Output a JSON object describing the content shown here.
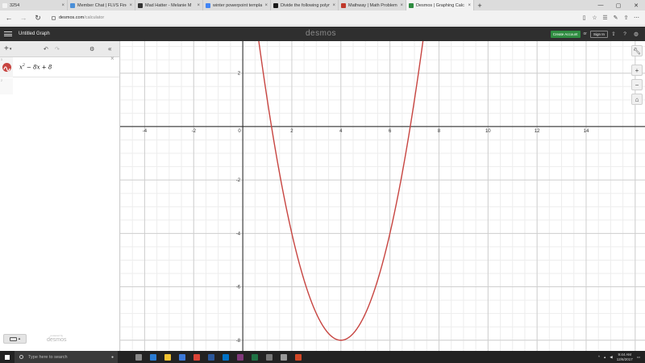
{
  "browser": {
    "tabs": [
      {
        "label": "3254",
        "color": "#f2f2f2",
        "icon": "blank-page-icon"
      },
      {
        "label": "Member Chat | FLVS Fine Ar",
        "color": "#4a8fd8",
        "icon": "flvs-icon"
      },
      {
        "label": "Mad Hatter - Melanie M",
        "color": "#333333",
        "icon": "music-icon"
      },
      {
        "label": "winter powerpoint templat",
        "color": "#4285f4",
        "icon": "google-icon"
      },
      {
        "label": "Divide the following polyno",
        "color": "#1a1a1a",
        "icon": "brainly-icon"
      },
      {
        "label": "Mathway | Math Problem So",
        "color": "#c0392b",
        "icon": "mathway-icon"
      },
      {
        "label": "Desmos | Graphing Calc",
        "color": "#2f8c41",
        "icon": "desmos-icon"
      }
    ],
    "url_host": "desmos.com",
    "url_path": "/calculator"
  },
  "desmos": {
    "graph_title": "Untitled Graph",
    "logo": "desmos",
    "create_account": "Create Account",
    "or": "or",
    "sign_in": "Sign In",
    "expression": {
      "index": "1",
      "latex_parts": {
        "x": "x",
        "exp": "2",
        "rest": " − 8x + 8"
      },
      "color": "#c74440"
    },
    "next_index": "2",
    "powered_by": "powered by",
    "powered_brand": "desmos"
  },
  "chart_data": {
    "type": "line",
    "function": "x^2 - 8x + 8",
    "xlim": [
      -5,
      16.4
    ],
    "ylim": [
      -8.4,
      3.2
    ],
    "x_ticks": [
      -4,
      -2,
      0,
      2,
      4,
      6,
      8,
      10,
      12,
      14
    ],
    "y_ticks": [
      -8,
      -6,
      -4,
      -2,
      2
    ],
    "grid": true,
    "series": [
      {
        "color": "#c74440"
      }
    ]
  },
  "taskbar": {
    "search_placeholder": "Type here to search",
    "time": "9:44 AM",
    "date": "12/6/2017"
  }
}
